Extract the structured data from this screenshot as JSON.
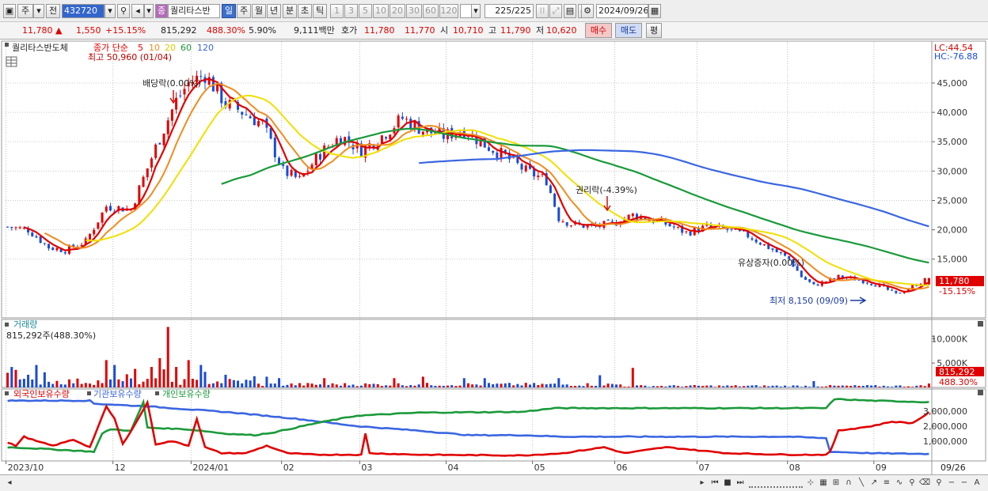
{
  "toolbar": {
    "type_label": "주",
    "prev_label": "전",
    "stock_code": "432720",
    "stock_badge": "종",
    "stock_name": "퀄리타스반",
    "periods": [
      "일",
      "주",
      "월",
      "년",
      "분",
      "초",
      "틱"
    ],
    "active_period": "일",
    "intervals": [
      "1",
      "3",
      "5",
      "10",
      "20",
      "30",
      "60",
      "120"
    ],
    "count": "225",
    "total": "/225",
    "date": "2024/09/26"
  },
  "infobar": {
    "price": "11,780",
    "change": "1,550",
    "change_pct": "+15.15%",
    "volume": "815,292",
    "volume_ratio": "488.30%",
    "turnover": "5.90%",
    "amount": "9,111백만",
    "bid_label": "호가",
    "ask": "11,780",
    "bid": "11,770",
    "open_label": "시",
    "open": "10,710",
    "high_label": "고",
    "high": "11,790",
    "low_label": "저",
    "low": "10,620",
    "buy_label": "매수",
    "sell_label": "매도",
    "eval_label": "평"
  },
  "colors": {
    "up": "#e00000",
    "down": "#1a4bd6",
    "ma5": "#e00000",
    "ma10": "#f08c1e",
    "ma20": "#f0e000",
    "ma60": "#1a9a3a",
    "ma120": "#3a66e0",
    "foreign": "#3a66e0",
    "institution": "#1a9a3a",
    "individual": "#e00000"
  },
  "chart_data": [
    {
      "type": "candlestick",
      "title": "퀄리타스반도체",
      "legend": {
        "label": "종가 단순",
        "periods": [
          "5",
          "10",
          "20",
          "60",
          "120"
        ]
      },
      "ylim": [
        5000,
        52000
      ],
      "y_ticks": [
        15000,
        20000,
        25000,
        30000,
        35000,
        40000,
        45000
      ],
      "y_tick_labels": [
        "15,000",
        "20,000",
        "25,000",
        "30,000",
        "35,000",
        "40,000",
        "45,000"
      ],
      "corner_labels": [
        "LC:44.54",
        "HC:-76.88"
      ],
      "current_price_label": "11,780",
      "current_change_label": "-15.15%",
      "annotations": {
        "high": "최고 50,960 (01/04)",
        "dividend": "배당락(0.00%)",
        "rights": "권리락(-4.39%)",
        "paid_in": "유상증자(0.00%)",
        "low": "최저 8,150 (09/09)"
      },
      "anchors": [
        [
          0,
          20500
        ],
        [
          5,
          20000
        ],
        [
          10,
          17000
        ],
        [
          14,
          16500
        ],
        [
          19,
          18000
        ],
        [
          24,
          24000
        ],
        [
          30,
          23500
        ],
        [
          36,
          34000
        ],
        [
          41,
          42000
        ],
        [
          44,
          45000
        ],
        [
          48,
          46500
        ],
        [
          53,
          41500
        ],
        [
          56,
          40500
        ],
        [
          62,
          38000
        ],
        [
          67,
          30000
        ],
        [
          71,
          28500
        ],
        [
          76,
          33000
        ],
        [
          81,
          36000
        ],
        [
          86,
          33500
        ],
        [
          91,
          36000
        ],
        [
          96,
          39000
        ],
        [
          101,
          37000
        ],
        [
          106,
          36000
        ],
        [
          111,
          37000
        ],
        [
          116,
          34500
        ],
        [
          121,
          32500
        ],
        [
          126,
          30000
        ],
        [
          131,
          28500
        ],
        [
          134,
          22000
        ],
        [
          137,
          21000
        ],
        [
          142,
          20500
        ],
        [
          147,
          21000
        ],
        [
          152,
          22500
        ],
        [
          155,
          22000
        ],
        [
          160,
          21000
        ],
        [
          165,
          19500
        ],
        [
          170,
          20500
        ],
        [
          175,
          20000
        ],
        [
          180,
          19000
        ],
        [
          185,
          17000
        ],
        [
          190,
          15000
        ],
        [
          193,
          12000
        ],
        [
          196,
          10500
        ],
        [
          202,
          12000
        ],
        [
          207,
          11500
        ],
        [
          212,
          10500
        ],
        [
          216,
          9000
        ],
        [
          219,
          10000
        ],
        [
          224,
          11780
        ]
      ]
    },
    {
      "type": "bar",
      "title": "거래량",
      "summary": "815,292주(488.30%)",
      "y_ticks": [
        5000,
        10000
      ],
      "y_tick_labels": [
        "5,000K",
        "10,000K"
      ],
      "current_label": "815,292",
      "current_pct_label": "488.30%",
      "spikes": [
        [
          0,
          3000
        ],
        [
          1,
          4200
        ],
        [
          2,
          3600
        ],
        [
          5,
          2600
        ],
        [
          7,
          4600
        ],
        [
          9,
          3100
        ],
        [
          24,
          5600
        ],
        [
          26,
          4600
        ],
        [
          29,
          2700
        ],
        [
          31,
          3800
        ],
        [
          35,
          4200
        ],
        [
          37,
          6000
        ],
        [
          38,
          3700
        ],
        [
          39,
          12400
        ],
        [
          41,
          4200
        ],
        [
          44,
          5600
        ],
        [
          47,
          4600
        ],
        [
          48,
          3200
        ],
        [
          53,
          2600
        ],
        [
          60,
          2300
        ],
        [
          63,
          2200
        ],
        [
          66,
          1900
        ],
        [
          77,
          1900
        ],
        [
          94,
          1900
        ],
        [
          101,
          2200
        ],
        [
          111,
          1900
        ],
        [
          116,
          1900
        ],
        [
          134,
          1900
        ],
        [
          144,
          2500
        ],
        [
          152,
          4000
        ],
        [
          196,
          1300
        ],
        [
          224,
          800
        ]
      ]
    },
    {
      "type": "line",
      "series_names": [
        "외국인보유수량",
        "기관보유수량",
        "개인보유수량"
      ],
      "y_ticks": [
        1000000,
        2000000,
        3000000
      ],
      "y_tick_labels": [
        "1,000,000",
        "2,000,000",
        "3,000,000"
      ],
      "foreign": [
        [
          0,
          3700000
        ],
        [
          20,
          3700000
        ],
        [
          21,
          3500000
        ],
        [
          35,
          3300000
        ],
        [
          45,
          3100000
        ],
        [
          55,
          2900000
        ],
        [
          70,
          2500000
        ],
        [
          85,
          2000000
        ],
        [
          100,
          1700000
        ],
        [
          112,
          1400000
        ],
        [
          125,
          1400000
        ],
        [
          135,
          1300000
        ],
        [
          150,
          1300000
        ],
        [
          190,
          1300000
        ],
        [
          199,
          1200000
        ],
        [
          200,
          300000
        ],
        [
          210,
          200000
        ],
        [
          224,
          150000
        ]
      ],
      "institution": [
        [
          0,
          600000
        ],
        [
          8,
          500000
        ],
        [
          21,
          300000
        ],
        [
          23,
          1500000
        ],
        [
          25,
          1800000
        ],
        [
          30,
          1700000
        ],
        [
          33,
          3600000
        ],
        [
          34,
          1900000
        ],
        [
          43,
          1800000
        ],
        [
          47,
          1700000
        ],
        [
          53,
          1500000
        ],
        [
          60,
          1400000
        ],
        [
          65,
          1600000
        ],
        [
          75,
          2200000
        ],
        [
          85,
          2700000
        ],
        [
          100,
          2900000
        ],
        [
          125,
          2950000
        ],
        [
          133,
          3200000
        ],
        [
          150,
          3200000
        ],
        [
          180,
          3200000
        ],
        [
          199,
          3200000
        ],
        [
          201,
          3800000
        ],
        [
          210,
          3700000
        ],
        [
          224,
          3600000
        ]
      ],
      "individual": [
        [
          0,
          900000
        ],
        [
          2,
          700000
        ],
        [
          4,
          1300000
        ],
        [
          7,
          1000000
        ],
        [
          11,
          700000
        ],
        [
          16,
          1100000
        ],
        [
          20,
          600000
        ],
        [
          24,
          3300000
        ],
        [
          26,
          2500000
        ],
        [
          28,
          800000
        ],
        [
          32,
          2600000
        ],
        [
          34,
          3600000
        ],
        [
          36,
          800000
        ],
        [
          40,
          1000000
        ],
        [
          44,
          700000
        ],
        [
          46,
          2500000
        ],
        [
          48,
          600000
        ],
        [
          52,
          200000
        ],
        [
          58,
          200000
        ],
        [
          63,
          700000
        ],
        [
          68,
          200000
        ],
        [
          75,
          100000
        ],
        [
          86,
          100000
        ],
        [
          87,
          1500000
        ],
        [
          88,
          200000
        ],
        [
          100,
          100000
        ],
        [
          125,
          50000
        ],
        [
          135,
          200000
        ],
        [
          145,
          600000
        ],
        [
          150,
          200000
        ],
        [
          160,
          600000
        ],
        [
          175,
          200000
        ],
        [
          190,
          100000
        ],
        [
          199,
          100000
        ],
        [
          200,
          300000
        ],
        [
          202,
          1700000
        ],
        [
          210,
          2000000
        ],
        [
          215,
          2300000
        ],
        [
          220,
          2200000
        ],
        [
          224,
          2900000
        ]
      ]
    }
  ],
  "x_axis": {
    "labels": [
      "2023/10",
      "12",
      "2024/01",
      "02",
      "03",
      "04",
      "05",
      "06",
      "07",
      "08",
      "09"
    ],
    "label_indices": [
      0,
      26,
      45,
      67,
      86,
      107,
      128,
      148,
      168,
      190,
      211
    ],
    "right_label": "09/26"
  }
}
